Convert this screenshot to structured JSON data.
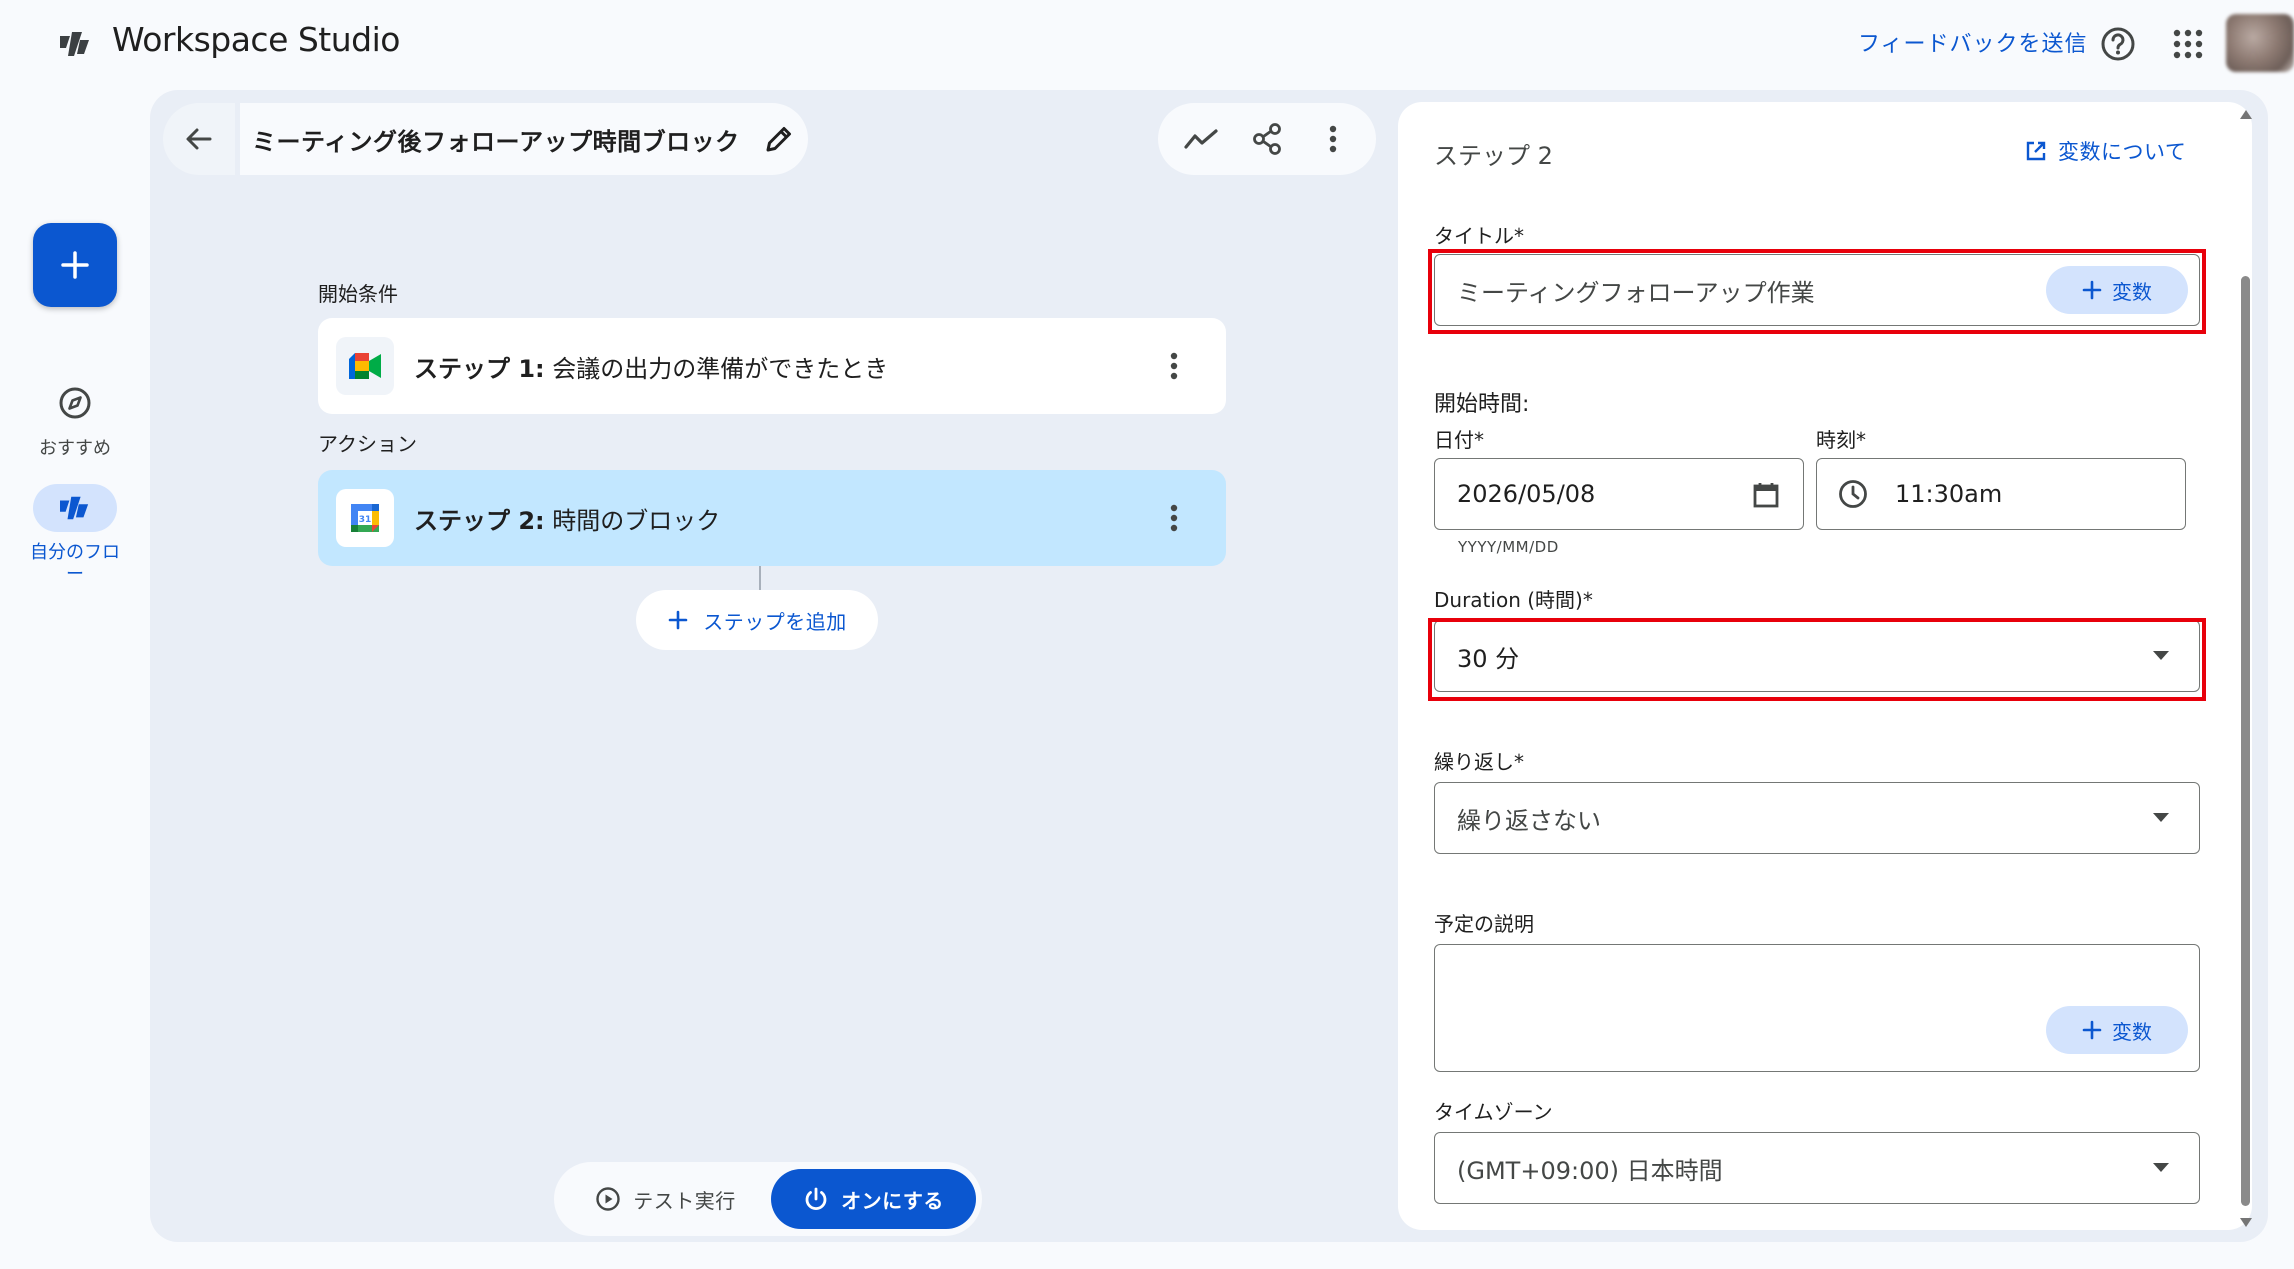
{
  "app": {
    "title": "Workspace Studio",
    "feedback_label": "フィードバックを送信",
    "accent_color": "#0b57d0"
  },
  "rail": {
    "create_icon": "plus-icon",
    "items": [
      {
        "label": "おすすめ",
        "icon": "explore-icon"
      },
      {
        "label": "自分のフロー",
        "icon": "workspace-studio-icon",
        "active": true
      }
    ]
  },
  "flow": {
    "title": "ミーティング後フォローアップ時間ブロック",
    "trigger_section": "開始条件",
    "action_section": "アクション",
    "steps": [
      {
        "prefix": "ステップ 1:",
        "title": "会議の出力の準備ができたとき",
        "app_icon": "google-meet-icon"
      },
      {
        "prefix": "ステップ 2:",
        "title": "時間のブロック",
        "app_icon": "google-calendar-icon",
        "selected": true
      }
    ],
    "add_step_label": "ステップを追加",
    "test_run_label": "テスト実行",
    "turn_on_label": "オンにする"
  },
  "panel": {
    "heading": "ステップ 2",
    "vars_about_label": "変数について",
    "title_label": "タイトル*",
    "title_value": "ミーティングフォローアップ作業",
    "variable_chip_label": "変数",
    "start_time_label": "開始時間:",
    "date_label": "日付*",
    "date_value": "2026/05/08",
    "date_hint": "YYYY/MM/DD",
    "time_label": "時刻*",
    "time_value": "11:30am",
    "duration_label": "Duration (時間)*",
    "duration_value": "30 分",
    "repeat_label": "繰り返し*",
    "repeat_value": "繰り返さない",
    "description_label": "予定の説明",
    "description_value": "",
    "timezone_label": "タイムゾーン",
    "timezone_value": "(GMT+09:00) 日本時間",
    "highlight_color": "#e8000b"
  }
}
